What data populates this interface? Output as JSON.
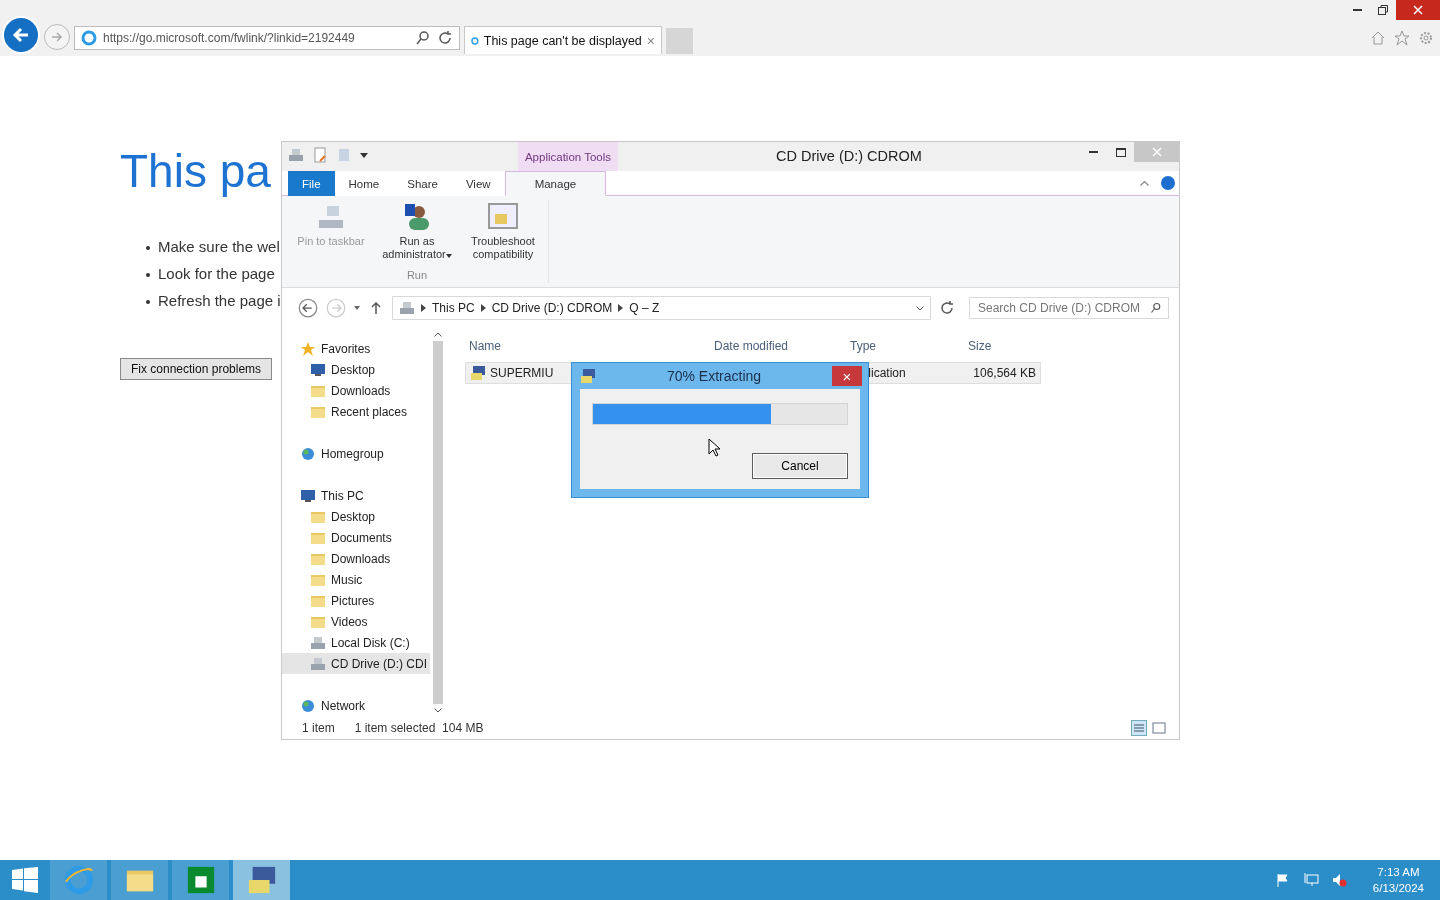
{
  "browser": {
    "url": "https://go.microsoft.com/fwlink/?linkid=2192449",
    "tab": {
      "title": "This page can't be displayed",
      "close": "×",
      "selected": true
    }
  },
  "page": {
    "heading": "This pa",
    "bullets": [
      "Make sure the wel",
      "Look for the page",
      "Refresh the page i"
    ],
    "button": "Fix connection problems"
  },
  "explorer": {
    "title": "CD Drive (D:) CDROM",
    "context_tab": "Application Tools",
    "tabs": [
      {
        "label": "File",
        "kind": "file",
        "selected": false
      },
      {
        "label": "Home",
        "kind": "plain",
        "selected": false
      },
      {
        "label": "Share",
        "kind": "plain",
        "selected": false
      },
      {
        "label": "View",
        "kind": "plain",
        "selected": false
      },
      {
        "label": "Manage",
        "kind": "context",
        "selected": true
      }
    ],
    "commands": [
      {
        "label": "Pin to taskbar",
        "disabled": true,
        "dropdown": false
      },
      {
        "label": "Run as administrator",
        "disabled": false,
        "dropdown": true
      },
      {
        "label": "Troubleshoot compatibility",
        "disabled": false,
        "dropdown": false
      }
    ],
    "group_label": "Run",
    "breadcrumbs": [
      "This PC",
      "CD Drive (D:) CDROM",
      "Q – Z"
    ],
    "search": {
      "placeholder": "Search CD Drive (D:) CDROM"
    },
    "nav": [
      {
        "label": "Favorites",
        "selected": false,
        "children": [
          {
            "label": "Desktop",
            "selected": false
          },
          {
            "label": "Downloads",
            "selected": false
          },
          {
            "label": "Recent places",
            "selected": false
          }
        ]
      },
      {
        "label": "Homegroup",
        "selected": false
      },
      {
        "label": "This PC",
        "selected": false,
        "children": [
          {
            "label": "Desktop",
            "selected": false
          },
          {
            "label": "Documents",
            "selected": false
          },
          {
            "label": "Downloads",
            "selected": false
          },
          {
            "label": "Music",
            "selected": false
          },
          {
            "label": "Pictures",
            "selected": false
          },
          {
            "label": "Videos",
            "selected": false
          },
          {
            "label": "Local Disk (C:)",
            "selected": false
          },
          {
            "label": "CD Drive (D:) CDI",
            "selected": true
          }
        ]
      },
      {
        "label": "Network",
        "selected": false
      }
    ],
    "columns": [
      "Name",
      "Date modified",
      "Type",
      "Size"
    ],
    "rows": [
      {
        "name": "SUPERMIU",
        "type": "lication",
        "size": "106,564 KB",
        "selected": true
      }
    ],
    "status": {
      "count": "1 item",
      "selection": "1 item selected  104 MB"
    }
  },
  "dialog": {
    "title": "70% Extracting",
    "close": "×",
    "level": 0.7,
    "button": "Cancel"
  },
  "taskbar": {
    "apps": [
      {
        "selected": false
      },
      {
        "selected": false
      },
      {
        "selected": false
      },
      {
        "selected": true
      }
    ],
    "time": "7:13 AM",
    "date": "6/13/2024"
  }
}
